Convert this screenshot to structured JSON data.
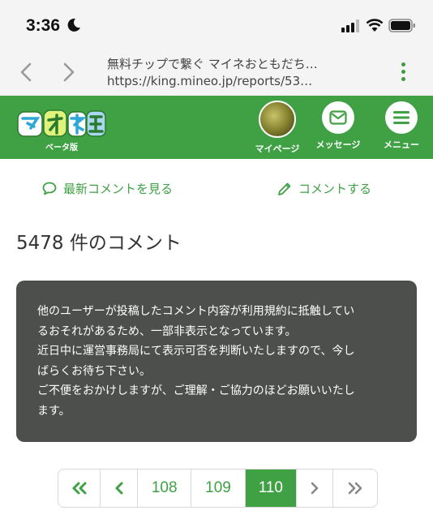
{
  "status_bar": {
    "time": "3:36"
  },
  "browser": {
    "tab_title": "無料チップで繋ぐ マイネおともだち…",
    "url": "https://king.mineo.jp/reports/53…"
  },
  "header": {
    "logo_text": "マイネ王",
    "beta_label": "ベータ版",
    "mypage_label": "マイページ",
    "message_label": "メッセージ",
    "menu_label": "メニュー",
    "brand_color": "#3fa144"
  },
  "actions": {
    "latest_comments": "最新コメントを見る",
    "write_comment": "コメントする"
  },
  "comment_count": "5478 件のコメント",
  "notice": {
    "line1": "他のユーザーが投稿したコメント内容が利用規約に抵触してい",
    "line2": "るおそれがあるため、一部非表示となっています。",
    "line3": "近日中に運営事務局にて表示可否を判断いたしますので、今し",
    "line4": "ばらくお待ち下さい。",
    "line5": "ご不便をおかけしますが、ご理解・ご協力のほどお願いいたし",
    "line6": "ます。"
  },
  "pagination": {
    "pages": [
      "108",
      "109",
      "110"
    ],
    "current": "110"
  }
}
